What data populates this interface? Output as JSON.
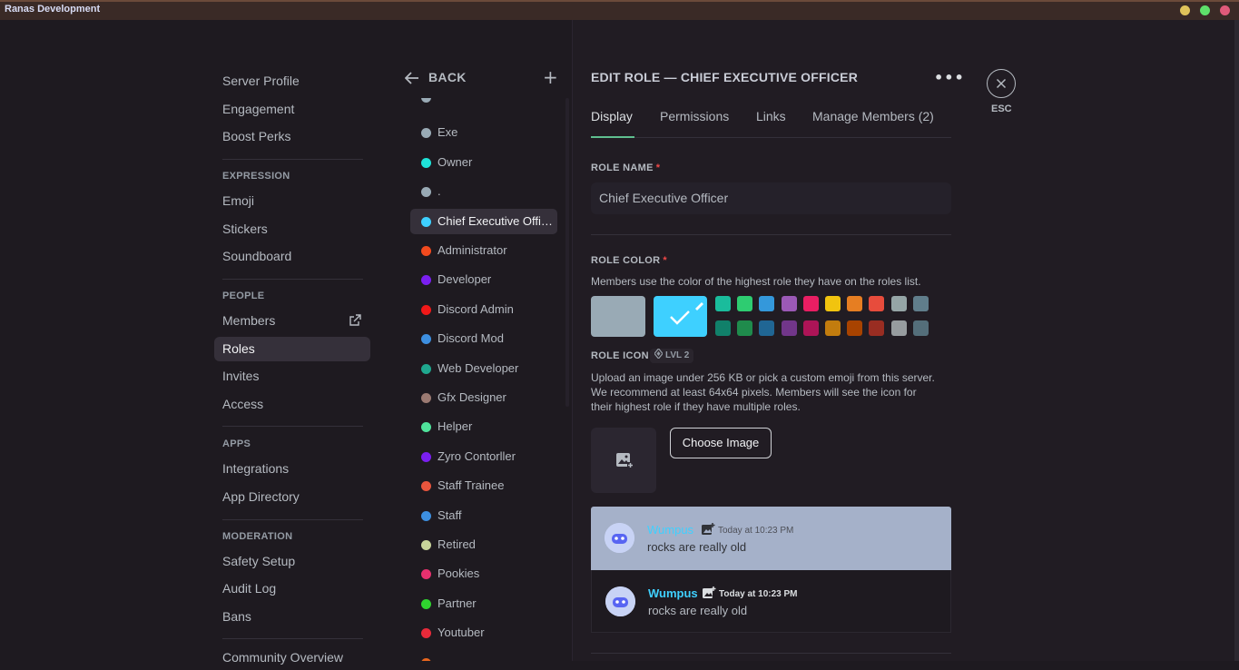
{
  "window": {
    "title": "Ranas Development"
  },
  "sidebar": {
    "items": [
      {
        "label": "Server Profile"
      },
      {
        "label": "Engagement"
      },
      {
        "label": "Boost Perks"
      }
    ],
    "expression": {
      "heading": "EXPRESSION",
      "items": [
        "Emoji",
        "Stickers",
        "Soundboard"
      ]
    },
    "people": {
      "heading": "PEOPLE",
      "items": [
        "Members",
        "Roles",
        "Invites",
        "Access"
      ]
    },
    "apps": {
      "heading": "APPS",
      "items": [
        "Integrations",
        "App Directory"
      ]
    },
    "moderation": {
      "heading": "MODERATION",
      "items": [
        "Safety Setup",
        "Audit Log",
        "Bans"
      ]
    },
    "community": {
      "items": [
        "Community Overview"
      ]
    }
  },
  "roles_panel": {
    "back_label": "BACK",
    "plus": "+",
    "roles": [
      {
        "name": "Exe",
        "color": "#99aab5"
      },
      {
        "name": "Owner",
        "color": "#1fe3d8"
      },
      {
        "name": ".",
        "color": "#99aab5"
      },
      {
        "name": "Chief Executive Officer",
        "color": "#3ed0ff"
      },
      {
        "name": "Administrator",
        "color": "#f24a1e"
      },
      {
        "name": "Developer",
        "color": "#7a1ff0"
      },
      {
        "name": "Discord Admin",
        "color": "#f01818"
      },
      {
        "name": "Discord Mod",
        "color": "#3d8fe0"
      },
      {
        "name": "Web Developer",
        "color": "#1fa88f"
      },
      {
        "name": "Gfx Designer",
        "color": "#9b7a72"
      },
      {
        "name": "Helper",
        "color": "#4fe39b"
      },
      {
        "name": "Zyro Contorller",
        "color": "#7a1ff0"
      },
      {
        "name": "Staff Trainee",
        "color": "#e8553d"
      },
      {
        "name": "Staff",
        "color": "#3d8fe0"
      },
      {
        "name": "Retired",
        "color": "#c8d49a"
      },
      {
        "name": "Pookies",
        "color": "#e8306e"
      },
      {
        "name": "Partner",
        "color": "#2fd32f"
      },
      {
        "name": "Youtuber",
        "color": "#e82a3a"
      }
    ]
  },
  "edit_role": {
    "title": "EDIT ROLE — CHIEF EXECUTIVE OFFICER",
    "more": "•••",
    "tabs": [
      "Display",
      "Permissions",
      "Links",
      "Manage Members (2)"
    ],
    "role_name_label": "ROLE NAME",
    "required": "*",
    "role_name_value": "Chief Executive Officer",
    "role_color_label": "ROLE COLOR",
    "role_color_desc": "Members use the color of the highest role they have on the roles list.",
    "default_color": "#99aab5",
    "selected_color": "#3ed0ff",
    "palette_top": [
      "#1abc9c",
      "#2ecc71",
      "#3498db",
      "#9b59b6",
      "#e91e63",
      "#f1c40f",
      "#e67e22",
      "#e74c3c",
      "#95a5a6",
      "#607d8b"
    ],
    "palette_bottom": [
      "#11806a",
      "#1f8b4c",
      "#206694",
      "#71368a",
      "#ad1457",
      "#c27c0e",
      "#a84300",
      "#992d22",
      "#979c9f",
      "#546e7a"
    ],
    "role_icon_label": "ROLE ICON",
    "level_badge": "LVL 2",
    "icon_desc_1": "Upload an image under 256 KB or pick a custom emoji from this server.",
    "icon_desc_2": "We recommend at least 64x64 pixels. Members will see the icon for",
    "icon_desc_3": "their highest role if they have multiple roles.",
    "choose_image": "Choose Image",
    "preview": {
      "name": "Wumpus",
      "time": "Today at 10:23 PM",
      "message": "rocks are really old"
    },
    "esc_label": "ESC"
  }
}
